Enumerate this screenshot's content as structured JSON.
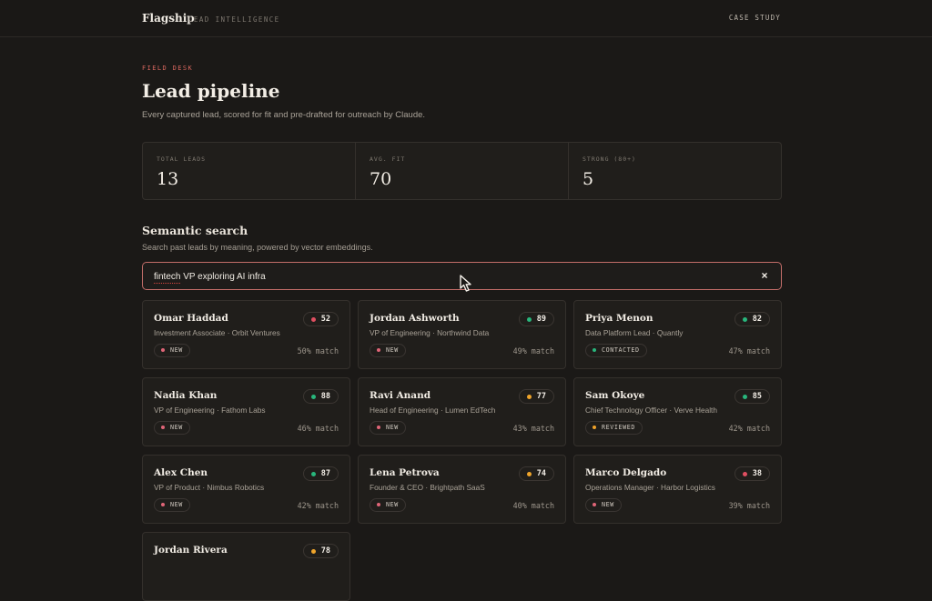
{
  "app": {
    "brand": "Flagship",
    "brand_subtitle": "LEAD INTELLIGENCE",
    "nav_link": "CASE STUDY"
  },
  "page": {
    "eyebrow": "FIELD DESK",
    "title": "Lead pipeline",
    "subtitle": "Every captured lead, scored for fit and pre-drafted for outreach by Claude."
  },
  "stats": [
    {
      "label": "TOTAL LEADS",
      "value": "13"
    },
    {
      "label": "AVG. FIT",
      "value": "70"
    },
    {
      "label": "STRONG (80+)",
      "value": "5"
    }
  ],
  "search": {
    "title": "Semantic search",
    "description": "Search past leads by meaning, powered by vector embeddings.",
    "query": "fintech VP exploring AI infra",
    "clear_icon": "close-icon"
  },
  "colors": {
    "green": "#28b67c",
    "orange": "#f0a52b",
    "red": "#e04f61",
    "status_new": "#df6577",
    "status_contacted": "#29b57c",
    "status_reviewed": "#efa22a"
  },
  "leads": [
    {
      "name": "Omar Haddad",
      "role": "Investment Associate · Orbit Ventures",
      "score": "52",
      "score_color": "#e04f61",
      "status": "NEW",
      "status_color": "#df6577",
      "match": "50% match"
    },
    {
      "name": "Jordan Ashworth",
      "role": "VP of Engineering · Northwind Data",
      "score": "89",
      "score_color": "#28b67c",
      "status": "NEW",
      "status_color": "#df6577",
      "match": "49% match"
    },
    {
      "name": "Priya Menon",
      "role": "Data Platform Lead · Quantly",
      "score": "82",
      "score_color": "#28b67c",
      "status": "CONTACTED",
      "status_color": "#29b57c",
      "match": "47% match"
    },
    {
      "name": "Nadia Khan",
      "role": "VP of Engineering · Fathom Labs",
      "score": "88",
      "score_color": "#28b67c",
      "status": "NEW",
      "status_color": "#df6577",
      "match": "46% match"
    },
    {
      "name": "Ravi Anand",
      "role": "Head of Engineering · Lumen EdTech",
      "score": "77",
      "score_color": "#f0a52b",
      "status": "NEW",
      "status_color": "#df6577",
      "match": "43% match"
    },
    {
      "name": "Sam Okoye",
      "role": "Chief Technology Officer · Verve Health",
      "score": "85",
      "score_color": "#28b67c",
      "status": "REVIEWED",
      "status_color": "#efa22a",
      "match": "42% match"
    },
    {
      "name": "Alex Chen",
      "role": "VP of Product · Nimbus Robotics",
      "score": "87",
      "score_color": "#28b67c",
      "status": "NEW",
      "status_color": "#df6577",
      "match": "42% match"
    },
    {
      "name": "Lena Petrova",
      "role": "Founder & CEO · Brightpath SaaS",
      "score": "74",
      "score_color": "#f0a52b",
      "status": "NEW",
      "status_color": "#df6577",
      "match": "40% match"
    },
    {
      "name": "Marco Delgado",
      "role": "Operations Manager · Harbor Logistics",
      "score": "38",
      "score_color": "#e04f61",
      "status": "NEW",
      "status_color": "#df6577",
      "match": "39% match"
    },
    {
      "name": "Jordan Rivera",
      "role": "",
      "score": "78",
      "score_color": "#f0a52b",
      "status": "",
      "status_color": "#df6577",
      "match": ""
    }
  ]
}
